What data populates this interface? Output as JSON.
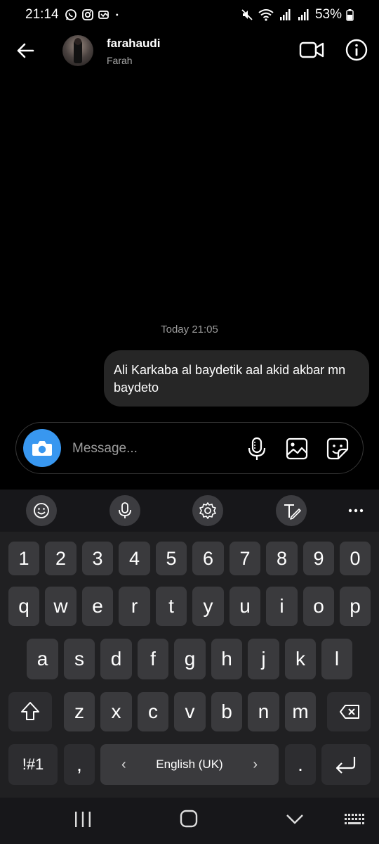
{
  "status_bar": {
    "time": "21:14",
    "battery": "53%"
  },
  "header": {
    "username": "farahaudi",
    "subname": "Farah"
  },
  "chat": {
    "timestamp": "Today 21:05",
    "messages": [
      {
        "text": "Ali Karkaba al baydetik aal akid akbar mn baydeto",
        "from": "me"
      }
    ]
  },
  "composer": {
    "placeholder": "Message..."
  },
  "keyboard": {
    "numbers": [
      "1",
      "2",
      "3",
      "4",
      "5",
      "6",
      "7",
      "8",
      "9",
      "0"
    ],
    "row1": [
      "q",
      "w",
      "e",
      "r",
      "t",
      "y",
      "u",
      "i",
      "o",
      "p"
    ],
    "row2": [
      "a",
      "s",
      "d",
      "f",
      "g",
      "h",
      "j",
      "k",
      "l"
    ],
    "row3": [
      "z",
      "x",
      "c",
      "v",
      "b",
      "n",
      "m"
    ],
    "symbols_label": "!#1",
    "comma": ",",
    "space_label": "English (UK)",
    "period": "."
  },
  "colors": {
    "accent": "#3897f0",
    "bubble": "#262626",
    "background": "#000000"
  }
}
